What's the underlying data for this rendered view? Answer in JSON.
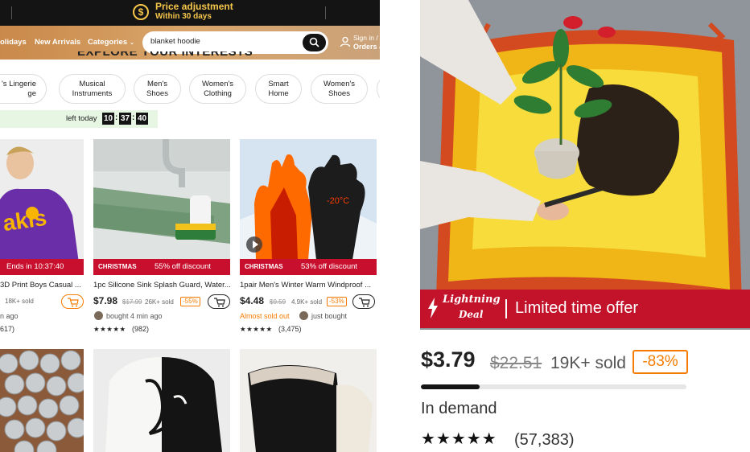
{
  "promo": {
    "title": "Price adjustment",
    "subtitle": "Within 30 days",
    "icon": "dollar-circle-icon",
    "color": "#f6c64b"
  },
  "nav": {
    "holidays": "olidays",
    "new_arrivals": "New Arrivals",
    "categories": "Categories",
    "search_value": "blanket hoodie",
    "signin": "Sign in /",
    "orders": "Orders &"
  },
  "section_title": "EXPLORE YOUR INTERESTS",
  "chips": [
    {
      "l1": "'s Lingerie",
      "l2": "ge"
    },
    {
      "l1": "Musical",
      "l2": "Instruments"
    },
    {
      "l1": "Men's",
      "l2": "Shoes"
    },
    {
      "l1": "Women's",
      "l2": "Clothing"
    },
    {
      "l1": "Smart",
      "l2": "Home"
    },
    {
      "l1": "Women's",
      "l2": "Shoes"
    }
  ],
  "timer": {
    "label": "left today",
    "hh": "10",
    "mm": "37",
    "ss": "40"
  },
  "products": [
    {
      "deal": "Ends in 10:37:40",
      "title": "3D Print Boys Casual ...",
      "price": "",
      "old_price": "",
      "sold": "18K+ sold",
      "discount": "",
      "meta": "n ago",
      "stars": "",
      "reviews": "617)"
    },
    {
      "badge": "CHRISTMAS",
      "deal": "55% off discount",
      "title": "1pc Silicone Sink Splash Guard, Water...",
      "price": "$7.98",
      "old_price": "$17.99",
      "sold": "26K+ sold",
      "discount": "-55%",
      "meta": "bought 4 min ago",
      "stars": "★★★★★",
      "reviews": "(982)"
    },
    {
      "badge": "CHRISTMAS",
      "deal": "53% off discount",
      "title": "1pair Men's Winter Warm Windproof ...",
      "price": "$4.48",
      "old_price": "$9.59",
      "sold": "4.9K+ sold",
      "discount": "-53%",
      "meta_orange": "Almost sold out",
      "meta": "just bought",
      "stars": "★★★★★",
      "reviews": "(3,475)"
    }
  ],
  "glove_text": "-20°C",
  "featured": {
    "lightning_line1": "Lightning",
    "lightning_line2": "Deal",
    "limited": "Limited time offer",
    "price": "$3.79",
    "old_price": "$22.51",
    "sold": "19K+ sold",
    "discount": "-83%",
    "progress": 0.22,
    "demand": "In demand",
    "stars": "★★★★★",
    "reviews": "(57,383)",
    "accent": "#c2132a"
  }
}
